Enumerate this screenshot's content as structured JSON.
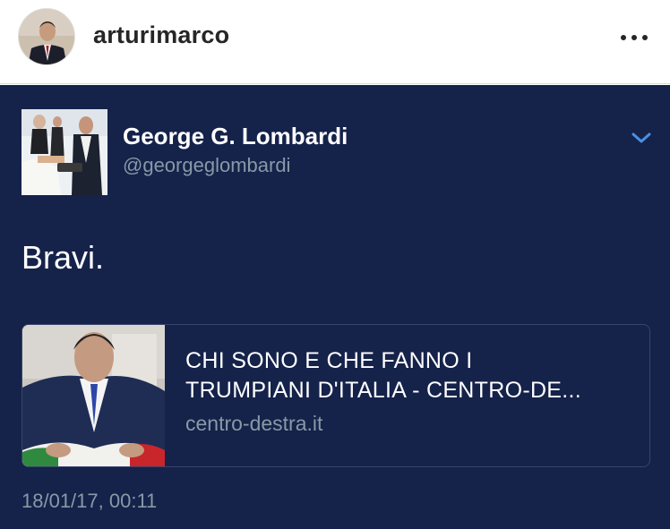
{
  "instagram_post": {
    "username": "arturimarco",
    "more_icon": "more-dots-icon"
  },
  "tweet": {
    "author_name": "George G. Lombardi",
    "author_handle": "@georgeglombardi",
    "menu_icon": "chevron-down-icon",
    "text": "Bravi.",
    "link_card": {
      "title_line1": "CHI SONO E CHE FANNO I",
      "title_line2": "TRUMPIANI D'ITALIA - CENTRO-DE...",
      "domain": "centro-destra.it"
    },
    "timestamp": "18/01/17, 00:11"
  },
  "colors": {
    "tweet_background": "#15224a",
    "secondary_text": "#8899a6",
    "accent": "#4a90e2"
  }
}
